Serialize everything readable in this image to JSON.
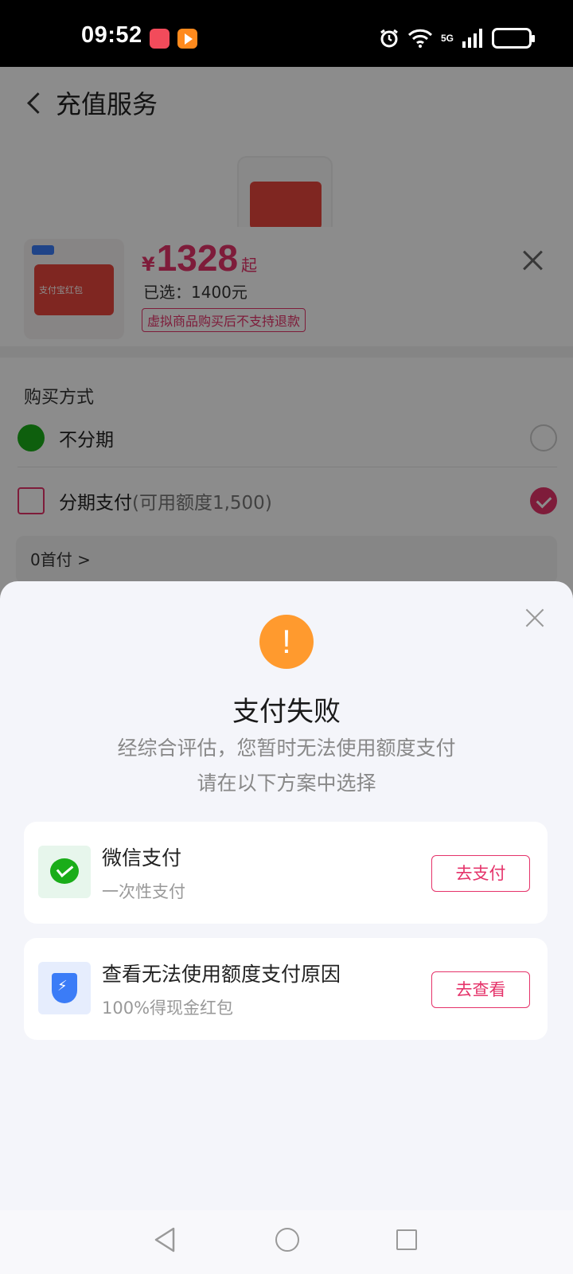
{
  "status_bar": {
    "time": "09:52",
    "network": "5G",
    "icons": [
      "shopping-app-icon",
      "video-app-icon",
      "alarm-icon",
      "wifi-icon",
      "signal-icon",
      "battery-icon"
    ]
  },
  "page": {
    "title": "充值服务"
  },
  "product_sheet": {
    "image_label": "支付宝红包",
    "price_symbol": "¥",
    "price": "1328",
    "price_suffix": "起",
    "selected": "已选：1400元",
    "notice": "虚拟商品购买后不支持退款",
    "section_title": "购买方式",
    "options": [
      {
        "label": "不分期",
        "sub": "",
        "selected": false
      },
      {
        "label": "分期支付",
        "sub": "(可用额度1,500)",
        "selected": true
      }
    ],
    "installment_text": "0首付 >"
  },
  "modal": {
    "icon": "!",
    "title": "支付失败",
    "desc_line1": "经综合评估，您暂时无法使用额度支付",
    "desc_line2": "请在以下方案中选择",
    "cards": [
      {
        "title": "微信支付",
        "subtitle": "一次性支付",
        "button": "去支付",
        "icon": "wechat-pay-icon"
      },
      {
        "title": "查看无法使用额度支付原因",
        "subtitle": "100%得现金红包",
        "button": "去查看",
        "icon": "shield-icon"
      }
    ]
  },
  "colors": {
    "accent": "#e5336a",
    "warning": "#ff9a2e",
    "wechat_green": "#1aad19",
    "shield_blue": "#3b7cf7",
    "modal_bg": "#f4f5fa"
  }
}
